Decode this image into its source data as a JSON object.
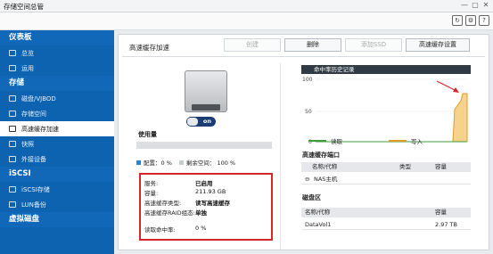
{
  "window": {
    "title": "存储空间总管",
    "min_glyph": "—",
    "max_glyph": "▢",
    "close_glyph": "✕"
  },
  "topbar": {
    "refresh_icon": "refresh-icon",
    "settings_icon": "gear-icon",
    "help_icon": "help-icon",
    "refresh_glyph": "↻",
    "settings_glyph": "⚙",
    "help_glyph": "?"
  },
  "sidebar": {
    "sections": [
      {
        "label": "仪表板",
        "items": [
          {
            "label": "总览"
          },
          {
            "label": "运用"
          }
        ]
      },
      {
        "label": "存储",
        "items": [
          {
            "label": "磁盘/VJBOD"
          },
          {
            "label": "存储空间"
          },
          {
            "label": "高速缓存加速",
            "active": true
          },
          {
            "label": "快照"
          },
          {
            "label": "外接设备"
          }
        ]
      },
      {
        "label": "iSCSI",
        "items": [
          {
            "label": "iSCSI存储"
          },
          {
            "label": "LUN备份"
          }
        ]
      },
      {
        "label": "虚拟磁盘"
      }
    ]
  },
  "main": {
    "title": "高速缓存加速",
    "buttons": {
      "create": "创建",
      "delete": "删除",
      "add_ssd": "添加SSD",
      "settings": "高速缓存设置"
    },
    "toggle_label": "on",
    "usage_label": "使用量",
    "usage_fraction": 0,
    "legend": {
      "allocated": "配置：0 %",
      "free": "剩余空间： 100 %",
      "allocated_color": "#2a83d0",
      "free_color": "#c8cbcf"
    },
    "info": [
      {
        "key": "服务:",
        "value": "已启用",
        "bold": true
      },
      {
        "key": "容量:",
        "value": "211.93 GB"
      },
      {
        "key": "高速缓存类型:",
        "value": "读写高速缓存",
        "bold": true
      },
      {
        "key": "高速缓存RAID组态:",
        "value": "单独",
        "bold": true
      },
      {
        "key": "读取命中率:",
        "value": "0 %"
      }
    ],
    "history": {
      "title": "命中率历史记录",
      "y_ticks": [
        "100",
        "50",
        "0"
      ],
      "legend_read": "读取",
      "legend_write": "写入",
      "read_color": "#3f9b3f",
      "write_color": "#e09a2b",
      "arrow_color": "#d4262b"
    },
    "port": {
      "title": "高速缓存端口",
      "columns": [
        "名称/代称",
        "类型",
        "容量"
      ],
      "rows": [
        {
          "name": "NAS主机",
          "expand_glyph": "⊖"
        }
      ]
    },
    "disk_area": {
      "title": "磁盘区",
      "columns": [
        "名称/代称",
        "容量"
      ],
      "rows": [
        {
          "name": "DataVol1",
          "capacity": "2.97 TB"
        }
      ]
    }
  }
}
